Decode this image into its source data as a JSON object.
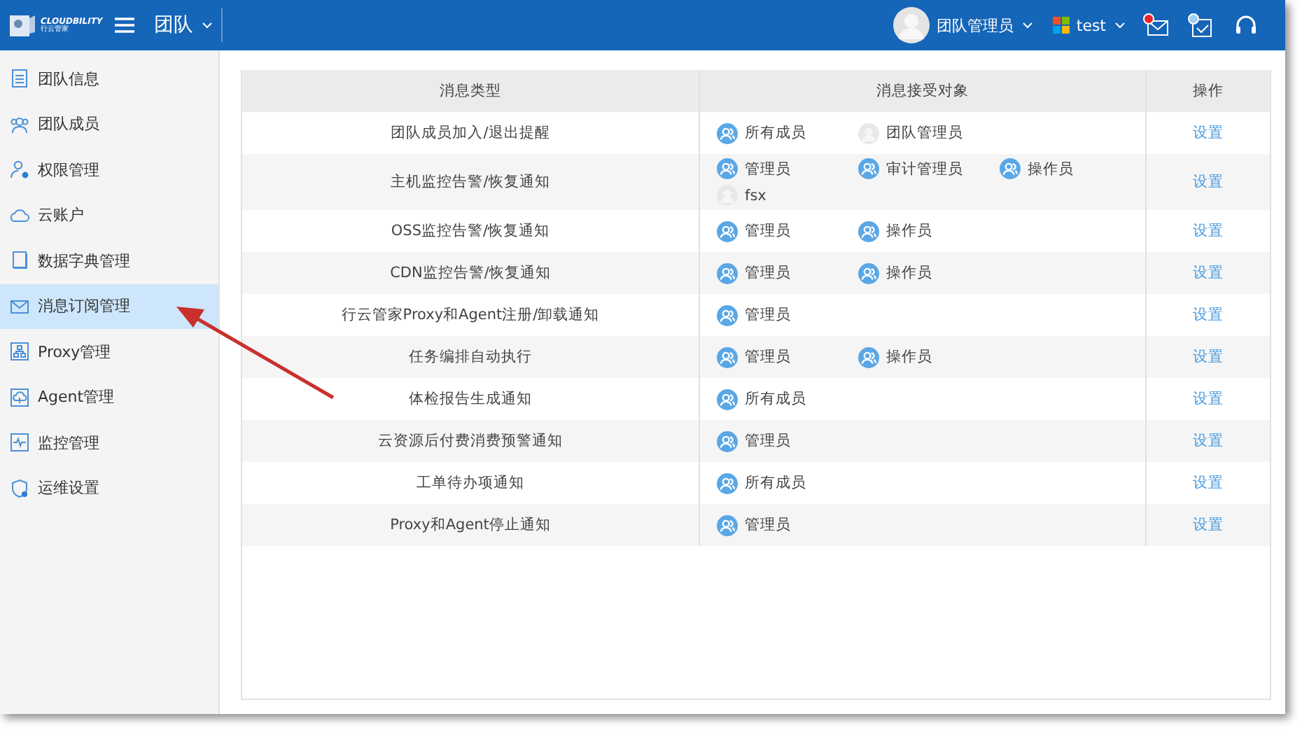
{
  "header": {
    "logo": {
      "name": "CLOUDBILITY",
      "subtitle": "行云管家"
    },
    "section": "团队",
    "user": "团队管理员",
    "team": "test",
    "notifications": [
      {
        "kind": "mail",
        "unread": true
      },
      {
        "kind": "task"
      },
      {
        "kind": "support"
      }
    ]
  },
  "sidebar": {
    "items": [
      {
        "label": "团队信息",
        "selected": false
      },
      {
        "label": "团队成员",
        "selected": false
      },
      {
        "label": "权限管理",
        "selected": false
      },
      {
        "label": "云账户",
        "selected": false
      },
      {
        "label": "数据字典管理",
        "selected": false
      },
      {
        "label": "消息订阅管理",
        "selected": true
      },
      {
        "label": "Proxy管理",
        "selected": false
      },
      {
        "label": "Agent管理",
        "selected": false
      },
      {
        "label": "监控管理",
        "selected": false
      },
      {
        "label": "运维设置",
        "selected": false
      }
    ]
  },
  "table": {
    "columns": [
      "消息类型",
      "消息接受对象",
      "操作"
    ],
    "rows": [
      {
        "type": "团队成员加入/退出提醒",
        "recipients": [
          {
            "kind": "group",
            "name": "所有成员"
          },
          {
            "kind": "user",
            "name": "团队管理员"
          }
        ],
        "action": "设置"
      },
      {
        "type": "主机监控告警/恢复通知",
        "recipients": [
          {
            "kind": "group",
            "name": "管理员"
          },
          {
            "kind": "group",
            "name": "审计管理员"
          },
          {
            "kind": "group",
            "name": "操作员"
          },
          {
            "kind": "user",
            "name": "fsx"
          }
        ],
        "action": "设置"
      },
      {
        "type": "OSS监控告警/恢复通知",
        "recipients": [
          {
            "kind": "group",
            "name": "管理员"
          },
          {
            "kind": "group",
            "name": "操作员"
          }
        ],
        "action": "设置"
      },
      {
        "type": "CDN监控告警/恢复通知",
        "recipients": [
          {
            "kind": "group",
            "name": "管理员"
          },
          {
            "kind": "group",
            "name": "操作员"
          }
        ],
        "action": "设置"
      },
      {
        "type": "行云管家Proxy和Agent注册/卸载通知",
        "recipients": [
          {
            "kind": "group",
            "name": "管理员"
          }
        ],
        "action": "设置"
      },
      {
        "type": "任务编排自动执行",
        "recipients": [
          {
            "kind": "group",
            "name": "管理员"
          },
          {
            "kind": "group",
            "name": "操作员"
          }
        ],
        "action": "设置"
      },
      {
        "type": "体检报告生成通知",
        "recipients": [
          {
            "kind": "group",
            "name": "所有成员"
          }
        ],
        "action": "设置"
      },
      {
        "type": "云资源后付费消费预警通知",
        "recipients": [
          {
            "kind": "group",
            "name": "管理员"
          }
        ],
        "action": "设置"
      },
      {
        "type": "工单待办项通知",
        "recipients": [
          {
            "kind": "group",
            "name": "所有成员"
          }
        ],
        "action": "设置"
      },
      {
        "type": "Proxy和Agent停止通知",
        "recipients": [
          {
            "kind": "group",
            "name": "管理员"
          }
        ],
        "action": "设置"
      }
    ]
  }
}
